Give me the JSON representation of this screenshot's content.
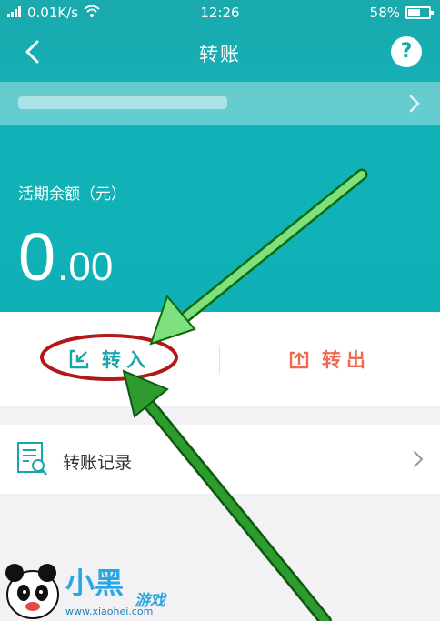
{
  "status_bar": {
    "signal": "4G",
    "speed": "0.01K/s",
    "time": "12:26",
    "battery": "58%",
    "battery_level": 0.58
  },
  "header": {
    "title": "转账"
  },
  "account": {
    "masked": true
  },
  "balance": {
    "label": "活期余额（元）",
    "integer": "0",
    "decimal": ".00"
  },
  "actions": {
    "transfer_in": "转入",
    "transfer_out": "转出"
  },
  "records": {
    "label": "转账记录"
  },
  "watermark": {
    "brand": "小黑",
    "sub": "游戏",
    "url": "www.xiaohei.com"
  },
  "colors": {
    "primary": "#15aeb3",
    "transfer_in": "#19a6ab",
    "transfer_out": "#ef6a4d",
    "annotation_green": "#2e9b2e",
    "annotation_light_green": "#7fe07f",
    "annotation_red": "#b21818"
  }
}
